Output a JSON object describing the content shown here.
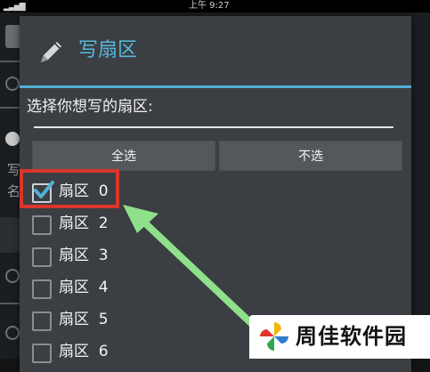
{
  "status_bar": {
    "time": "上午 9:27"
  },
  "background": {
    "line1": "写",
    "line2": "名"
  },
  "dialog": {
    "title": "写扇区",
    "prompt": "选择你想写的扇区:",
    "input_value": "",
    "select_all_label": "全选",
    "select_none_label": "不选",
    "sectors": [
      {
        "label": "扇区  0",
        "checked": true
      },
      {
        "label": "扇区  2",
        "checked": false
      },
      {
        "label": "扇区  3",
        "checked": false
      },
      {
        "label": "扇区  4",
        "checked": false
      },
      {
        "label": "扇区  5",
        "checked": false
      },
      {
        "label": "扇区  6",
        "checked": false
      }
    ]
  },
  "icons": {
    "title_icon": "pencil-icon",
    "check_icon": "checkmark-icon",
    "watermark_logo": "pinwheel-logo-icon"
  },
  "colors": {
    "accent": "#4fb0d6",
    "title": "#57b9de",
    "dialog_bg": "#3b3e42",
    "highlight": "#d9352b",
    "arrow": "#8fe08a"
  },
  "watermark": {
    "text": "周佳软件园"
  }
}
